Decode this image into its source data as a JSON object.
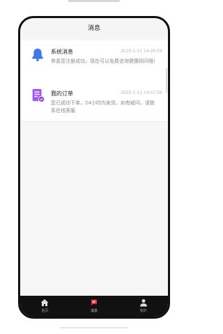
{
  "header": {
    "title": "消息"
  },
  "messages": [
    {
      "title": "系统消息",
      "time": "2025-1-11 14:26:59",
      "body": "恭喜您注册成功，现在可以免费咨询健康顾问哦!",
      "icon": "bell-icon",
      "icon_color": "#3d7be8"
    },
    {
      "title": "我的订单",
      "time": "2025-1-11 14:57:56",
      "body": "您已成功下单，24小时内发货，如有疑问，请联系在线客服",
      "icon": "order-document-icon",
      "icon_color": "#a855f7"
    }
  ],
  "tabbar": {
    "items": [
      {
        "label": "首页",
        "icon": "home-icon",
        "active": false
      },
      {
        "label": "消息",
        "icon": "message-icon",
        "active": true,
        "icon_color": "#d9302c"
      },
      {
        "label": "我的",
        "icon": "person-icon",
        "active": false
      }
    ]
  }
}
